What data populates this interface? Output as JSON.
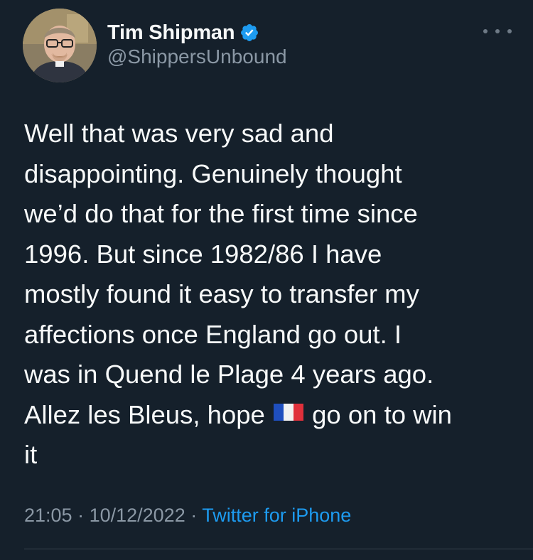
{
  "author": {
    "display_name": "Tim Shipman",
    "handle": "@ShippersUnbound",
    "verified": true,
    "avatar_icon": "avatar-photo"
  },
  "tweet": {
    "text_part1": "Well that was very sad and\ndisappointing. Genuinely thought\nwe’d do that for the first time since\n1996. But since 1982/86 I have\nmostly found it easy to transfer my\naffections once England go out. I\nwas in Quend le Plage 4 years ago.\nAllez les Bleus, hope ",
    "emoji": "french-flag-icon",
    "text_part2": " go on to win\nit"
  },
  "meta": {
    "time": "21:05",
    "separator1": " · ",
    "date": "10/12/2022",
    "separator2": " · ",
    "source": "Twitter for iPhone"
  },
  "colors": {
    "background": "#15202b",
    "text": "#f7f9f9",
    "secondary": "#8b98a5",
    "link": "#1d9bf0",
    "verified": "#1d9bf0"
  },
  "more_icon": "more-options-icon"
}
